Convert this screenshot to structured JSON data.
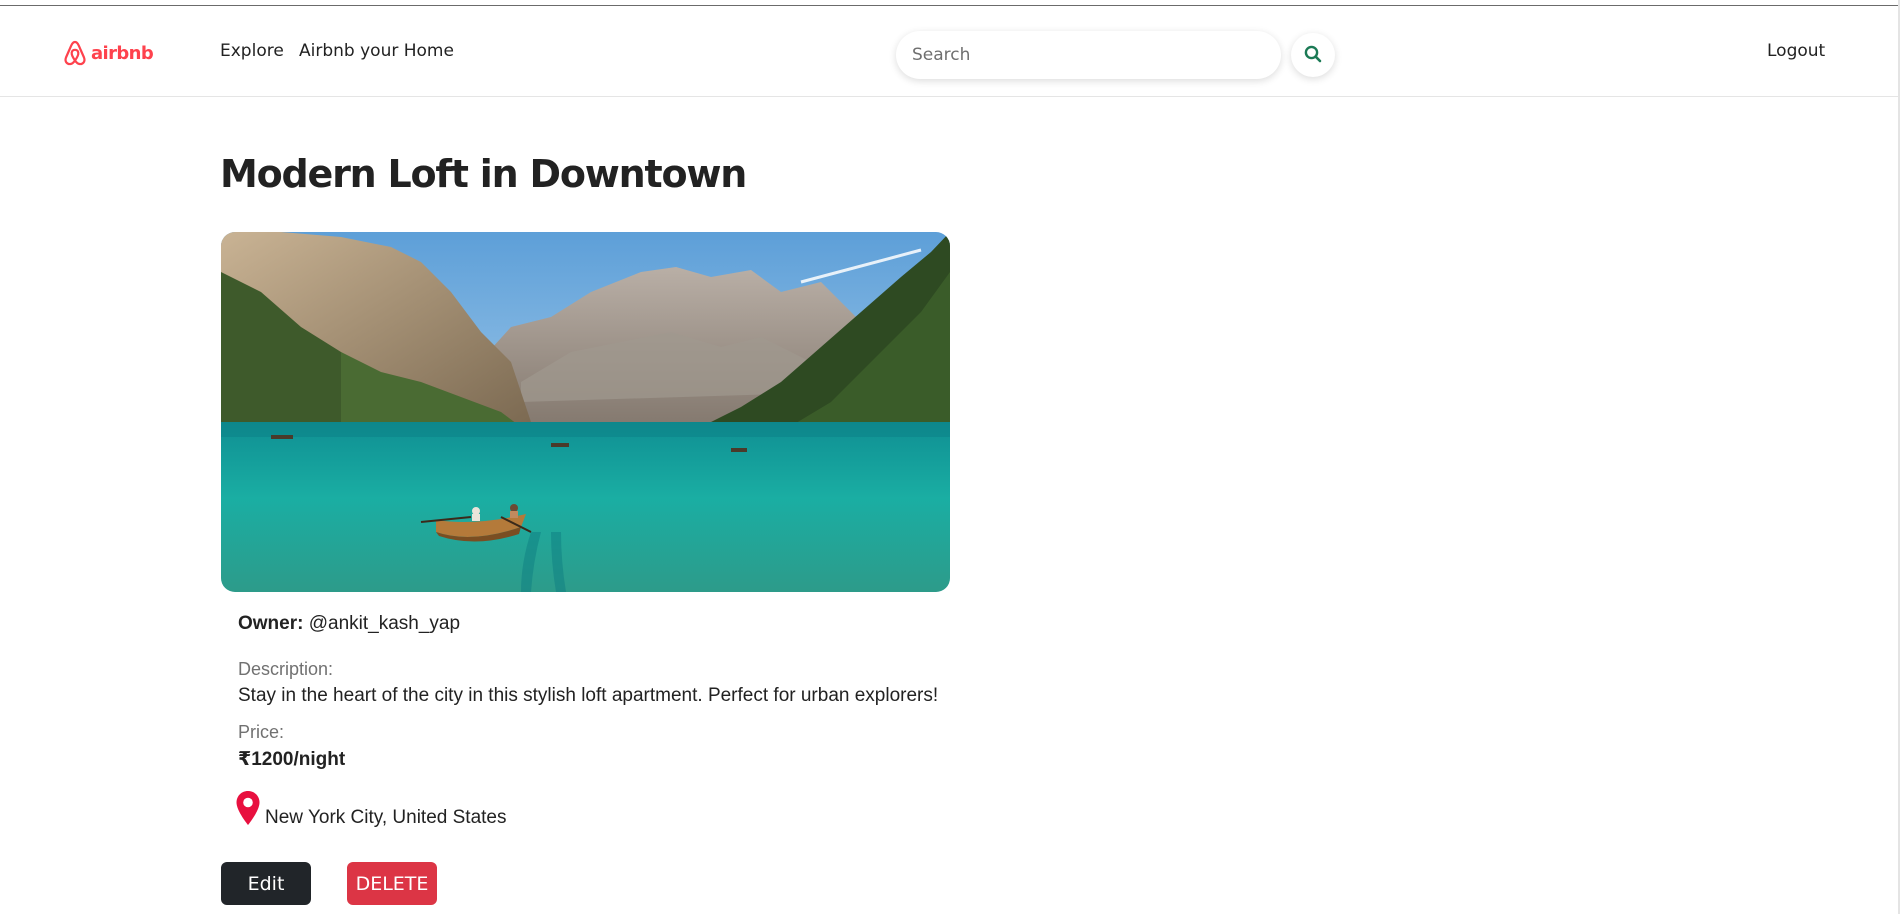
{
  "brand": {
    "name": "airbnb",
    "icon": "airbnb-logo-icon",
    "color": "#fe424d"
  },
  "nav": {
    "explore_label": "Explore",
    "host_label": "Airbnb your Home",
    "logout_label": "Logout"
  },
  "search": {
    "placeholder": "Search",
    "value": "",
    "button_icon": "search-icon",
    "button_icon_color": "#1b7a55"
  },
  "listing": {
    "title": "Modern Loft in Downtown",
    "image_icon": "mountain-lake-photo",
    "owner_label": "Owner:",
    "owner_value": "@ankit_kash_yap",
    "description_label": "Description:",
    "description": "Stay in the heart of the city in this stylish loft apartment. Perfect for urban explorers!",
    "price_label": "Price:",
    "price": "₹1200/night",
    "location_icon": "map-pin-icon",
    "location_icon_color": "#e8103f",
    "location": "New York City, United States"
  },
  "actions": {
    "edit_label": "Edit",
    "delete_label": "DELETE",
    "edit_color": "#212529",
    "delete_color": "#dc3545"
  }
}
